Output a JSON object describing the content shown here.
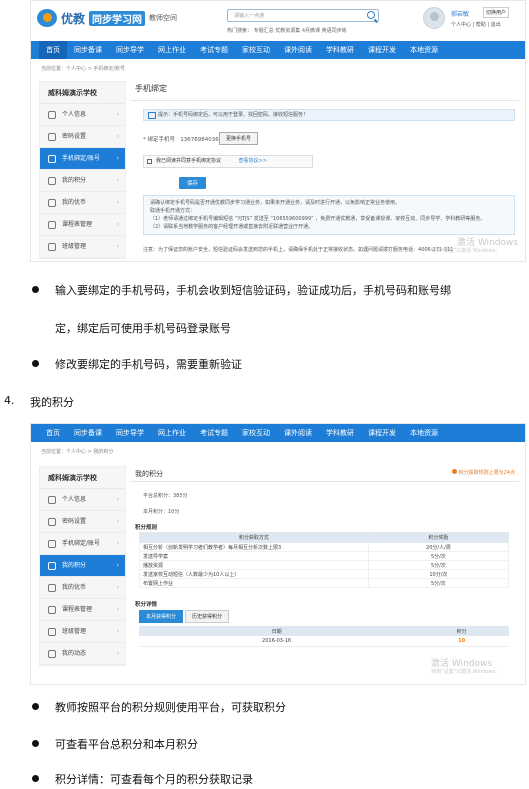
{
  "header": {
    "logo_main": "优教",
    "logo_sync": "同步学习网",
    "logo_sub": "教师空间",
    "search_placeholder": "请输入一点通",
    "hot_prefix": "热门搜索：",
    "hot_terms": [
      "专题汇总",
      "优教资源集",
      "4月微课",
      "英语同步练"
    ],
    "user_name": "郝岩敏",
    "switch_label": "切换用户",
    "user_links": [
      "个人中心",
      "帮助",
      "退出"
    ]
  },
  "nav": {
    "items": [
      "首页",
      "同步备课",
      "同步导学",
      "网上作业",
      "考试专题",
      "家校互动",
      "课外阅读",
      "学科教研",
      "课程开发",
      "本地资源"
    ]
  },
  "shot1": {
    "breadcrumb": "当前位置：个人中心 > 手机绑定/账号",
    "school": "威科姆演示学校",
    "menu": [
      {
        "label": "个人信息",
        "icon": "user-icon",
        "active": false
      },
      {
        "label": "密码设置",
        "icon": "key-icon",
        "active": false
      },
      {
        "label": "手机绑定/账号",
        "icon": "phone-icon",
        "active": true
      },
      {
        "label": "我的积分",
        "icon": "points-icon",
        "active": false
      },
      {
        "label": "我的优币",
        "icon": "coin-icon",
        "active": false
      },
      {
        "label": "课程表管理",
        "icon": "schedule-icon",
        "active": false
      },
      {
        "label": "班级管理",
        "icon": "class-icon",
        "active": false
      }
    ],
    "panel_title": "手机绑定",
    "tip": "提示：手机号码绑定后，可以用于登录、找回密码、接收短信服务！",
    "phone_label": "* 绑定手机号",
    "phone_value": "13676984036",
    "change_button": "更换手机号",
    "agree_text": "我已阅读并同意手机绑定协议",
    "view_protocol": "查看协议>>",
    "save_button": "保存",
    "note_lines": [
      "请确认绑定手机号码是否开通优教同步学习通业务，如果未开通业务，请及时进行开通，以免影响正常业务使用。",
      "取通手机开通方式：",
      "（1）老师请通过绑定手机号编辑短信 “YJTJS” 发送至 “106559600999” ，免费开通优教通，享受备课授课、家校互动、同步导学、学科教研等服务。",
      "（2）请联系当地教学服务的客户经理开通或直接去附近联通营业厅开通。"
    ],
    "footer_note": "注意：为了保证您的账户安全，短信验证码会发送到您的手机上，请确保手机处于正常接收状态，如遇问题请拨打服务电话：4006-271-311",
    "watermark": "激活 Windows",
    "watermark_sub": "转到“设置”以激活 Windows。"
  },
  "bullets1": [
    "输入要绑定的手机号码，手机会收到短信验证码，验证成功后，手机号码和账号绑",
    "定，绑定后可使用手机号码登录账号",
    "修改要绑定的手机号码，需要重新验证"
  ],
  "section4": {
    "number": "4.",
    "title": "我的积分"
  },
  "shot2": {
    "breadcrumb": "当前位置：个人中心 > 我的积分",
    "school": "威科姆演示学校",
    "menu": [
      {
        "label": "个人信息",
        "icon": "user-icon",
        "active": false
      },
      {
        "label": "密码设置",
        "icon": "key-icon",
        "active": false
      },
      {
        "label": "手机绑定/账号",
        "icon": "phone-icon",
        "active": false
      },
      {
        "label": "我的积分",
        "icon": "points-icon",
        "active": true
      },
      {
        "label": "我的优币",
        "icon": "coin-icon",
        "active": false
      },
      {
        "label": "课程表管理",
        "icon": "schedule-icon",
        "active": false
      },
      {
        "label": "班级管理",
        "icon": "class-icon",
        "active": false
      },
      {
        "label": "我的动态",
        "icon": "activity-icon",
        "active": false
      }
    ],
    "panel_title": "我的积分",
    "rule_link": "积分获取规则上限为24点",
    "total_points": "平台总积分：385分",
    "month_points": "本月积分：10分",
    "rules_title": "积分规则",
    "rules_headers": [
      "积分获取方式",
      "积分奖励"
    ],
    "rules_rows": [
      [
        "相互分析（创新发明学习者们教学者）每月相互分析次数上限3",
        "20分/人/周"
      ],
      [
        "发送导学案",
        "5分/次"
      ],
      [
        "播放资源",
        "5分/次"
      ],
      [
        "发送家校互动短信（人数最少为10人以上）",
        "10分/次"
      ],
      [
        "布置网上作业",
        "5分/次"
      ]
    ],
    "detail_title": "积分详情",
    "tabs": [
      "本月获得积分",
      "历史获得积分"
    ],
    "detail_headers": [
      "日期",
      "积分"
    ],
    "detail_rows": [
      [
        "2016-03-16",
        "10"
      ]
    ],
    "watermark": "激活 Windows",
    "watermark_sub": "转到“设置”以激活 Windows。"
  },
  "bullets2": [
    "教师按照平台的积分规则使用平台，可获取积分",
    "可查看平台总积分和本月积分",
    "积分详情：可查看每个月的积分获取记录"
  ]
}
